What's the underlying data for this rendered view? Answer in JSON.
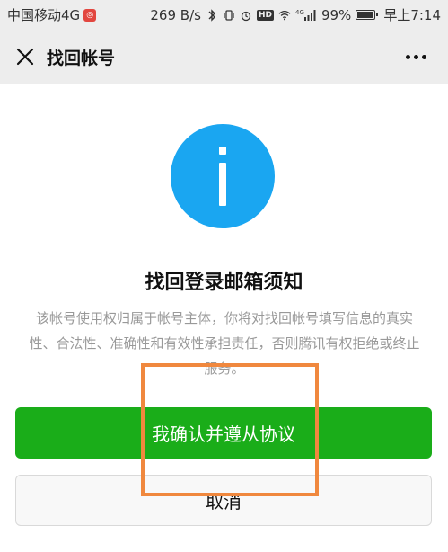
{
  "status_bar": {
    "carrier": "中国移动4G",
    "carrier_badge": "◎",
    "speed": "269 B/s",
    "network": "4G",
    "hd_label": "HD",
    "battery": "99%",
    "time": "早上7:14"
  },
  "navbar": {
    "title": "找回帐号"
  },
  "content": {
    "heading": "找回登录邮箱须知",
    "body": "该帐号使用权归属于帐号主体，你将对找回帐号填写信息的真实性、合法性、准确性和有效性承担责任，否则腾讯有权拒绝或终止服务。"
  },
  "buttons": {
    "confirm": "我确认并遵从协议",
    "cancel": "取消"
  },
  "colors": {
    "accent_green": "#1aad19",
    "info_blue": "#1aa6f1",
    "highlight_orange": "#f0883e"
  }
}
